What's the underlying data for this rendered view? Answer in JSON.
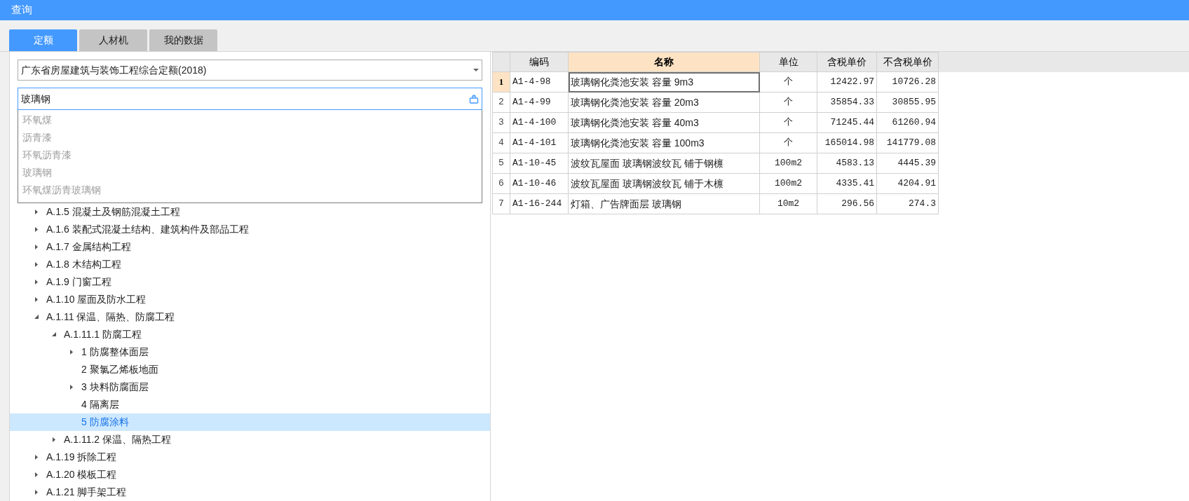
{
  "window": {
    "title": "查询"
  },
  "tabs": [
    {
      "label": "定额",
      "selected": true
    },
    {
      "label": "人材机",
      "selected": false
    },
    {
      "label": "我的数据",
      "selected": false
    }
  ],
  "library_select": {
    "value": "广东省房屋建筑与装饰工程综合定额(2018)"
  },
  "search": {
    "value": "玻璃钢",
    "suggestions": [
      "环氧煤",
      "沥青漆",
      "环氧沥青漆",
      "玻璃钢",
      "环氧煤沥青玻璃钢"
    ]
  },
  "tree": [
    {
      "label": "A.1.5 混凝土及钢筋混凝土工程",
      "expanded": false,
      "selected": false,
      "has_children": true
    },
    {
      "label": "A.1.6 装配式混凝土结构、建筑构件及部品工程",
      "expanded": false,
      "selected": false,
      "has_children": true
    },
    {
      "label": "A.1.7 金属结构工程",
      "expanded": false,
      "selected": false,
      "has_children": true
    },
    {
      "label": "A.1.8 木结构工程",
      "expanded": false,
      "selected": false,
      "has_children": true
    },
    {
      "label": "A.1.9 门窗工程",
      "expanded": false,
      "selected": false,
      "has_children": true
    },
    {
      "label": "A.1.10 屋面及防水工程",
      "expanded": false,
      "selected": false,
      "has_children": true
    },
    {
      "label": "A.1.11 保温、隔热、防腐工程",
      "expanded": true,
      "selected": false,
      "has_children": true,
      "children": [
        {
          "label": "A.1.11.1 防腐工程",
          "expanded": true,
          "selected": false,
          "has_children": true,
          "children": [
            {
              "label": "1 防腐整体面层",
              "expanded": false,
              "selected": false,
              "has_children": true
            },
            {
              "label": "2 聚氯乙烯板地面",
              "expanded": false,
              "selected": false,
              "has_children": false
            },
            {
              "label": "3 块料防腐面层",
              "expanded": false,
              "selected": false,
              "has_children": true
            },
            {
              "label": "4 隔离层",
              "expanded": false,
              "selected": false,
              "has_children": false
            },
            {
              "label": "5 防腐涂料",
              "expanded": false,
              "selected": true,
              "has_children": false
            }
          ]
        },
        {
          "label": "A.1.11.2 保温、隔热工程",
          "expanded": false,
          "selected": false,
          "has_children": true
        }
      ]
    },
    {
      "label": "A.1.19 拆除工程",
      "expanded": false,
      "selected": false,
      "has_children": true
    },
    {
      "label": "A.1.20 模板工程",
      "expanded": false,
      "selected": false,
      "has_children": true
    },
    {
      "label": "A.1.21 脚手架工程",
      "expanded": false,
      "selected": false,
      "has_children": true
    }
  ],
  "table": {
    "columns": [
      {
        "label": "编码",
        "selected": false
      },
      {
        "label": "名称",
        "selected": true
      },
      {
        "label": "单位",
        "selected": false
      },
      {
        "label": "含税单价",
        "selected": false
      },
      {
        "label": "不含税单价",
        "selected": false
      }
    ],
    "rows": [
      {
        "index": "1",
        "selected": true,
        "cells": [
          "A1-4-98",
          "玻璃钢化粪池安装 容量 9m3",
          "个",
          "12422.97",
          "10726.28"
        ]
      },
      {
        "index": "2",
        "selected": false,
        "cells": [
          "A1-4-99",
          "玻璃钢化粪池安装 容量 20m3",
          "个",
          "35854.33",
          "30855.95"
        ]
      },
      {
        "index": "3",
        "selected": false,
        "cells": [
          "A1-4-100",
          "玻璃钢化粪池安装 容量 40m3",
          "个",
          "71245.44",
          "61260.94"
        ]
      },
      {
        "index": "4",
        "selected": false,
        "cells": [
          "A1-4-101",
          "玻璃钢化粪池安装 容量 100m3",
          "个",
          "165014.98",
          "141779.08"
        ]
      },
      {
        "index": "5",
        "selected": false,
        "cells": [
          "A1-10-45",
          "波纹瓦屋面 玻璃钢波纹瓦 铺于钢檩",
          "100m2",
          "4583.13",
          "4445.39"
        ]
      },
      {
        "index": "6",
        "selected": false,
        "cells": [
          "A1-10-46",
          "波纹瓦屋面 玻璃钢波纹瓦 铺于木檩",
          "100m2",
          "4335.41",
          "4204.91"
        ]
      },
      {
        "index": "7",
        "selected": false,
        "cells": [
          "A1-16-244",
          "灯箱、广告牌面层 玻璃钢",
          "10m2",
          "296.56",
          "274.3"
        ]
      }
    ]
  }
}
